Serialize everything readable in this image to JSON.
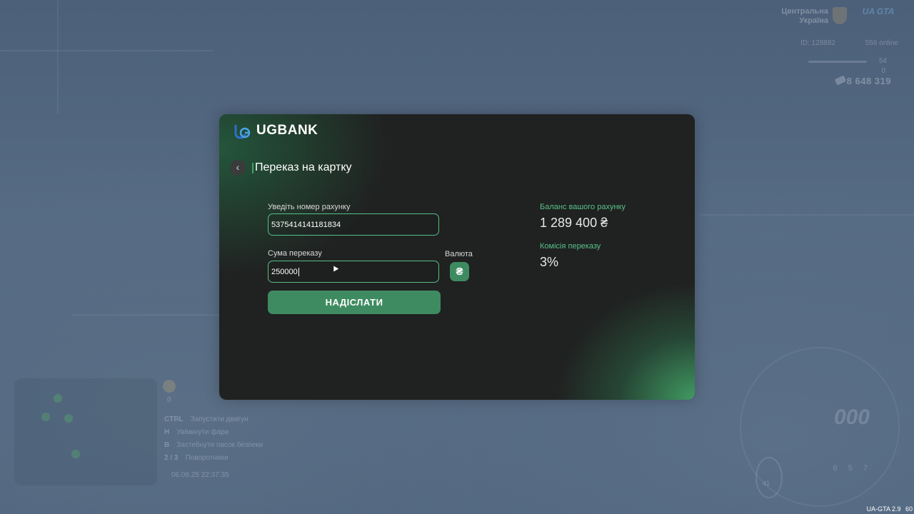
{
  "hud": {
    "region_line1": "Центральна",
    "region_line2": "Україна",
    "server_logo": "UA GTA",
    "id": "ID: 128882",
    "online": "556 online",
    "stat1": "54",
    "stat2": "0",
    "money": "8 648 319",
    "coin_value": "0",
    "hints": [
      {
        "key": "CTRL",
        "text": "Запустити двигун"
      },
      {
        "key": "H",
        "text": "Увімкнути фари"
      },
      {
        "key": "B",
        "text": "Застебнути пасок безпеки"
      },
      {
        "key": "2 / 3",
        "text": "Поворотники"
      }
    ],
    "datetime": "06.06.25 22:37:35",
    "speed": "000",
    "gears": [
      "6",
      "5",
      "7"
    ],
    "fuel": "41",
    "version": "UA-GTA 2.9",
    "fps": "60"
  },
  "bank": {
    "logo_text": "UGBANK",
    "page_title": "Переказ на картку",
    "account_label": "Уведіть номер рахунку",
    "account_value": "5375414141181834",
    "amount_label": "Сума переказу",
    "amount_value": "250000",
    "currency_label": "Валюта",
    "currency_symbol": "₴",
    "send_label": "НАДІСЛАТИ",
    "balance_label": "Баланс вашого рахунку",
    "balance_value": "1 289 400 ₴",
    "commission_label": "Комісія переказу",
    "commission_value": "3%"
  },
  "colors": {
    "accent": "#3f8b61",
    "accent_light": "#56c28a",
    "panel_bg": "#202121",
    "backdrop": "#4f647d"
  },
  "icons": [
    "back-arrow-icon",
    "ugbank-logo-icon",
    "hryvnia-icon",
    "money-icon",
    "region-emblem-icon"
  ]
}
